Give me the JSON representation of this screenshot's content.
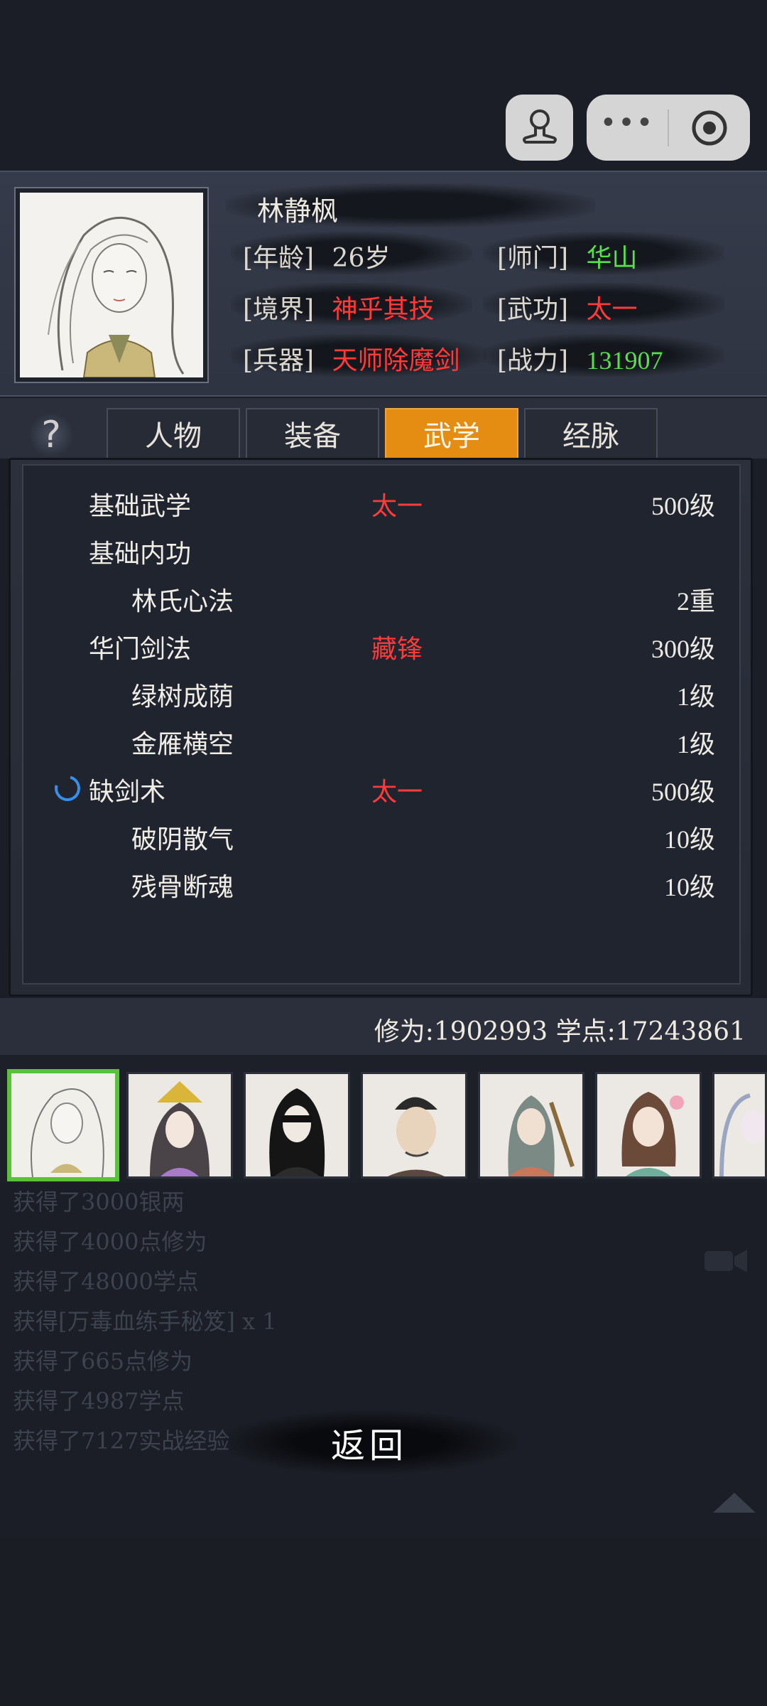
{
  "hero": {
    "name": "林静枫",
    "age_label": "[年龄]",
    "age_value": "26岁",
    "sect_label": "[师门]",
    "sect_value": "华山",
    "realm_label": "[境界]",
    "realm_value": "神乎其技",
    "martial_label": "[武功]",
    "martial_value": "太一",
    "weapon_label": "[兵器]",
    "weapon_value": "天师除魔剑",
    "power_label": "[战力]",
    "power_value": "131907"
  },
  "tabs": [
    {
      "label": "人物",
      "active": false
    },
    {
      "label": "装备",
      "active": false
    },
    {
      "label": "武学",
      "active": true
    },
    {
      "label": "经脉",
      "active": false
    }
  ],
  "skills": [
    {
      "name": "基础武学",
      "tag": "太一",
      "level": "500级",
      "indent": false,
      "spinner": false
    },
    {
      "name": "基础内功",
      "tag": "",
      "level": "",
      "indent": false,
      "spinner": false
    },
    {
      "name": "林氏心法",
      "tag": "",
      "level": "2重",
      "indent": true,
      "spinner": false
    },
    {
      "name": "华门剑法",
      "tag": "藏锋",
      "level": "300级",
      "indent": false,
      "spinner": false
    },
    {
      "name": "绿树成荫",
      "tag": "",
      "level": "1级",
      "indent": true,
      "spinner": false
    },
    {
      "name": "金雁横空",
      "tag": "",
      "level": "1级",
      "indent": true,
      "spinner": false
    },
    {
      "name": "缺剑术",
      "tag": "太一",
      "level": "500级",
      "indent": false,
      "spinner": true
    },
    {
      "name": "破阴散气",
      "tag": "",
      "level": "10级",
      "indent": true,
      "spinner": false
    },
    {
      "name": "残骨断魂",
      "tag": "",
      "level": "10级",
      "indent": true,
      "spinner": false
    }
  ],
  "stats": {
    "text": "修为:1902993  学点:17243861"
  },
  "log": [
    "获得了3000银两",
    "获得了4000点修为",
    "获得了48000学点",
    "获得[万毒血练手秘笈] x 1",
    "获得了665点修为",
    "获得了4987学点",
    "获得了7127实战经验"
  ],
  "back_label": "返回",
  "colors": {
    "accent_tab": "#e58d13",
    "red_text": "#ff3a3a",
    "green_text": "#56e04a",
    "selected_border": "#5ac23a"
  }
}
